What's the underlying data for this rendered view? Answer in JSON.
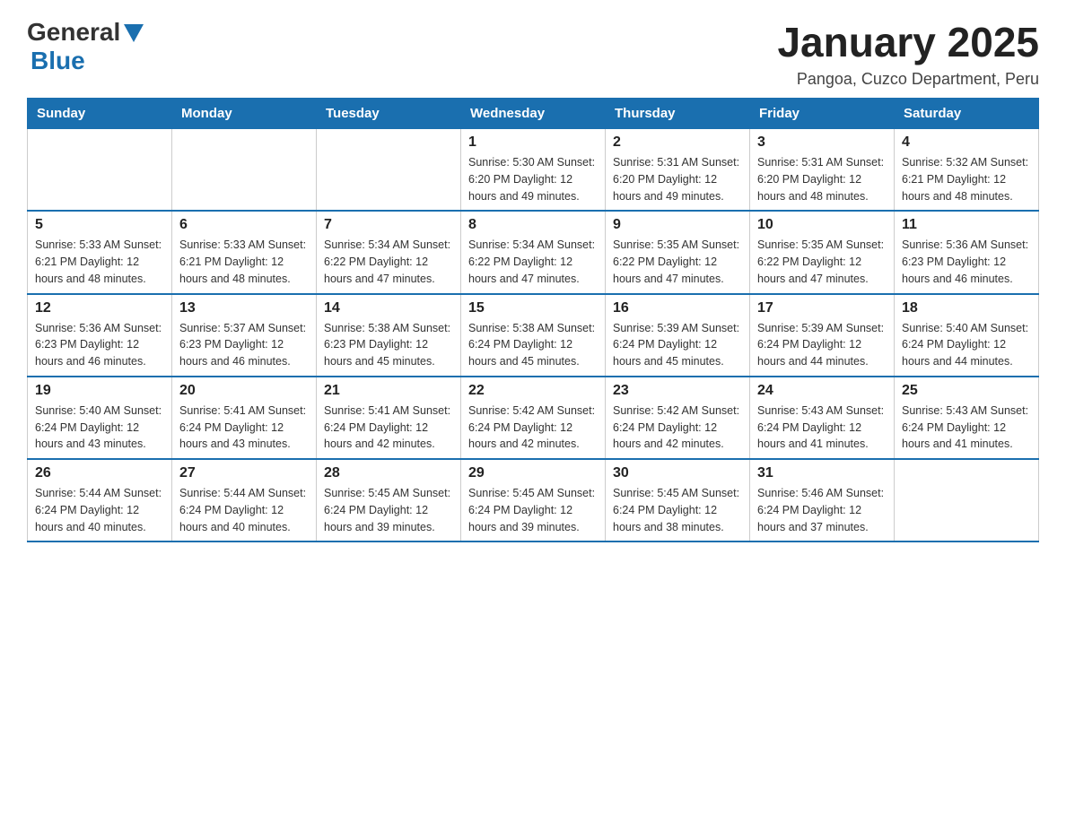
{
  "header": {
    "logo_general": "General",
    "logo_blue": "Blue",
    "title": "January 2025",
    "subtitle": "Pangoa, Cuzco Department, Peru"
  },
  "calendar": {
    "days_of_week": [
      "Sunday",
      "Monday",
      "Tuesday",
      "Wednesday",
      "Thursday",
      "Friday",
      "Saturday"
    ],
    "weeks": [
      [
        {
          "day": "",
          "info": ""
        },
        {
          "day": "",
          "info": ""
        },
        {
          "day": "",
          "info": ""
        },
        {
          "day": "1",
          "info": "Sunrise: 5:30 AM\nSunset: 6:20 PM\nDaylight: 12 hours\nand 49 minutes."
        },
        {
          "day": "2",
          "info": "Sunrise: 5:31 AM\nSunset: 6:20 PM\nDaylight: 12 hours\nand 49 minutes."
        },
        {
          "day": "3",
          "info": "Sunrise: 5:31 AM\nSunset: 6:20 PM\nDaylight: 12 hours\nand 48 minutes."
        },
        {
          "day": "4",
          "info": "Sunrise: 5:32 AM\nSunset: 6:21 PM\nDaylight: 12 hours\nand 48 minutes."
        }
      ],
      [
        {
          "day": "5",
          "info": "Sunrise: 5:33 AM\nSunset: 6:21 PM\nDaylight: 12 hours\nand 48 minutes."
        },
        {
          "day": "6",
          "info": "Sunrise: 5:33 AM\nSunset: 6:21 PM\nDaylight: 12 hours\nand 48 minutes."
        },
        {
          "day": "7",
          "info": "Sunrise: 5:34 AM\nSunset: 6:22 PM\nDaylight: 12 hours\nand 47 minutes."
        },
        {
          "day": "8",
          "info": "Sunrise: 5:34 AM\nSunset: 6:22 PM\nDaylight: 12 hours\nand 47 minutes."
        },
        {
          "day": "9",
          "info": "Sunrise: 5:35 AM\nSunset: 6:22 PM\nDaylight: 12 hours\nand 47 minutes."
        },
        {
          "day": "10",
          "info": "Sunrise: 5:35 AM\nSunset: 6:22 PM\nDaylight: 12 hours\nand 47 minutes."
        },
        {
          "day": "11",
          "info": "Sunrise: 5:36 AM\nSunset: 6:23 PM\nDaylight: 12 hours\nand 46 minutes."
        }
      ],
      [
        {
          "day": "12",
          "info": "Sunrise: 5:36 AM\nSunset: 6:23 PM\nDaylight: 12 hours\nand 46 minutes."
        },
        {
          "day": "13",
          "info": "Sunrise: 5:37 AM\nSunset: 6:23 PM\nDaylight: 12 hours\nand 46 minutes."
        },
        {
          "day": "14",
          "info": "Sunrise: 5:38 AM\nSunset: 6:23 PM\nDaylight: 12 hours\nand 45 minutes."
        },
        {
          "day": "15",
          "info": "Sunrise: 5:38 AM\nSunset: 6:24 PM\nDaylight: 12 hours\nand 45 minutes."
        },
        {
          "day": "16",
          "info": "Sunrise: 5:39 AM\nSunset: 6:24 PM\nDaylight: 12 hours\nand 45 minutes."
        },
        {
          "day": "17",
          "info": "Sunrise: 5:39 AM\nSunset: 6:24 PM\nDaylight: 12 hours\nand 44 minutes."
        },
        {
          "day": "18",
          "info": "Sunrise: 5:40 AM\nSunset: 6:24 PM\nDaylight: 12 hours\nand 44 minutes."
        }
      ],
      [
        {
          "day": "19",
          "info": "Sunrise: 5:40 AM\nSunset: 6:24 PM\nDaylight: 12 hours\nand 43 minutes."
        },
        {
          "day": "20",
          "info": "Sunrise: 5:41 AM\nSunset: 6:24 PM\nDaylight: 12 hours\nand 43 minutes."
        },
        {
          "day": "21",
          "info": "Sunrise: 5:41 AM\nSunset: 6:24 PM\nDaylight: 12 hours\nand 42 minutes."
        },
        {
          "day": "22",
          "info": "Sunrise: 5:42 AM\nSunset: 6:24 PM\nDaylight: 12 hours\nand 42 minutes."
        },
        {
          "day": "23",
          "info": "Sunrise: 5:42 AM\nSunset: 6:24 PM\nDaylight: 12 hours\nand 42 minutes."
        },
        {
          "day": "24",
          "info": "Sunrise: 5:43 AM\nSunset: 6:24 PM\nDaylight: 12 hours\nand 41 minutes."
        },
        {
          "day": "25",
          "info": "Sunrise: 5:43 AM\nSunset: 6:24 PM\nDaylight: 12 hours\nand 41 minutes."
        }
      ],
      [
        {
          "day": "26",
          "info": "Sunrise: 5:44 AM\nSunset: 6:24 PM\nDaylight: 12 hours\nand 40 minutes."
        },
        {
          "day": "27",
          "info": "Sunrise: 5:44 AM\nSunset: 6:24 PM\nDaylight: 12 hours\nand 40 minutes."
        },
        {
          "day": "28",
          "info": "Sunrise: 5:45 AM\nSunset: 6:24 PM\nDaylight: 12 hours\nand 39 minutes."
        },
        {
          "day": "29",
          "info": "Sunrise: 5:45 AM\nSunset: 6:24 PM\nDaylight: 12 hours\nand 39 minutes."
        },
        {
          "day": "30",
          "info": "Sunrise: 5:45 AM\nSunset: 6:24 PM\nDaylight: 12 hours\nand 38 minutes."
        },
        {
          "day": "31",
          "info": "Sunrise: 5:46 AM\nSunset: 6:24 PM\nDaylight: 12 hours\nand 37 minutes."
        },
        {
          "day": "",
          "info": ""
        }
      ]
    ]
  }
}
